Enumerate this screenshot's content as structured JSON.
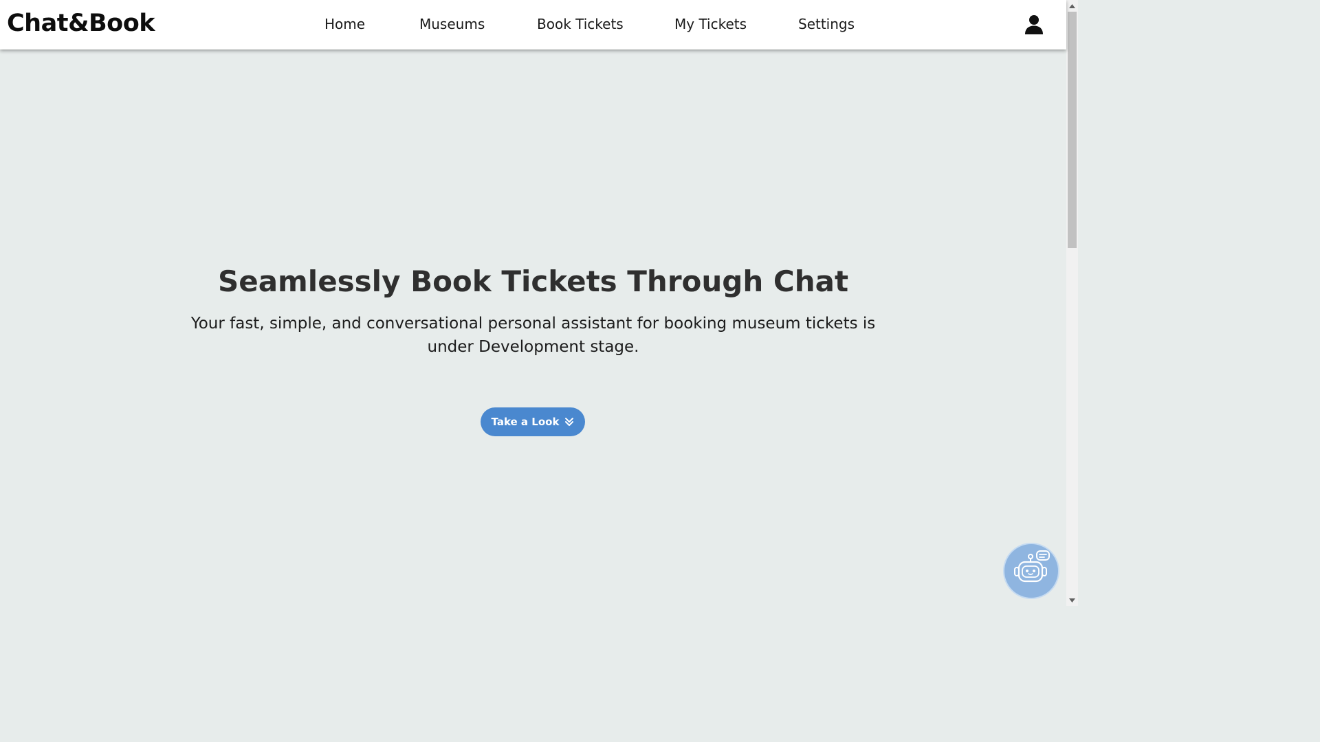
{
  "app": {
    "logo": "Chat&Book"
  },
  "nav": {
    "items": [
      {
        "label": "Home"
      },
      {
        "label": "Museums"
      },
      {
        "label": "Book Tickets"
      },
      {
        "label": "My Tickets"
      },
      {
        "label": "Settings"
      }
    ],
    "user_icon": "user-icon"
  },
  "hero": {
    "title": "Seamlessly Book Tickets Through Chat",
    "subtitle": "Your fast, simple, and conversational personal assistant for booking museum tickets is under Development stage.",
    "cta_label": "Take a Look",
    "cta_icon": "chevron-double-down-icon"
  },
  "chatbot": {
    "icon": "chatbot-icon"
  },
  "colors": {
    "background": "#e7eceb",
    "header": "#ffffff",
    "accent": "#4a88cf",
    "chatbot_bg": "#8fb5e0",
    "text_dark": "#2f2f2f"
  }
}
